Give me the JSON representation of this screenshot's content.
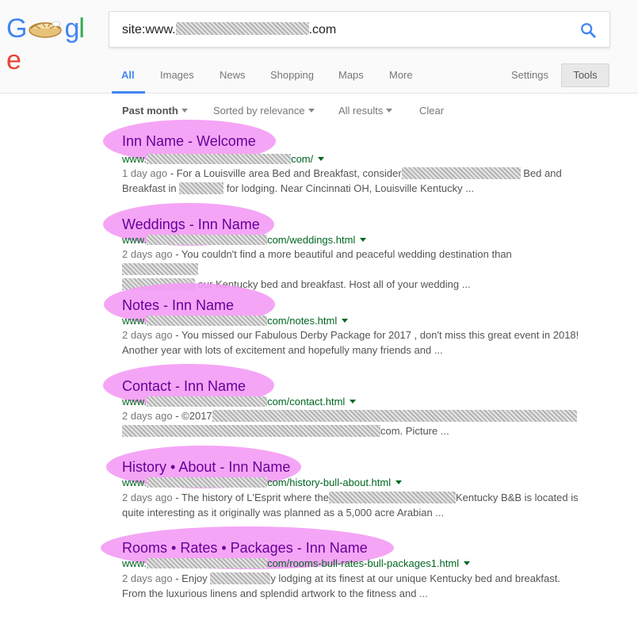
{
  "search": {
    "query_prefix": "site:www.",
    "query_suffix": ".com"
  },
  "logo": {
    "g1": "G",
    "g2": "g",
    "l": "l",
    "e": "e"
  },
  "tabs": [
    {
      "label": "All",
      "active": true
    },
    {
      "label": "Images"
    },
    {
      "label": "News"
    },
    {
      "label": "Shopping"
    },
    {
      "label": "Maps"
    },
    {
      "label": "More"
    }
  ],
  "settings_label": "Settings",
  "tools_label": "Tools",
  "filters": {
    "time": "Past month",
    "sort": "Sorted by relevance",
    "results": "All results",
    "clear": "Clear"
  },
  "results": [
    {
      "title": "Inn Name  - Welcome",
      "url_prefix": "www.",
      "url_suffix": "com/",
      "snippet_date": "1 day ago",
      "snippet_a": " - For a Louisville area Bed and Breakfast, consider",
      "snippet_b": " Bed and",
      "snippet_c": "Breakfast in",
      "snippet_d": " for lodging. Near Cincinnati OH, Louisville Kentucky ..."
    },
    {
      "title": "Weddings - Inn Name",
      "url_prefix": "www.",
      "url_suffix": "com/weddings.html",
      "snippet_date": "2 days ago",
      "snippet_a": " - You couldn't find a more beautiful and peaceful wedding destination than",
      "snippet_b": " our Kentucky bed and breakfast. Host all of your wedding ..."
    },
    {
      "title": "Notes - Inn Name",
      "url_prefix": "www.",
      "url_suffix": "com/notes.html",
      "snippet_date": "2 days ago",
      "snippet_a": " - You missed our Fabulous Derby Package for 2017 , don't miss this great event in 2018!",
      "snippet_b": "Another year with lots of excitement and hopefully many friends and ..."
    },
    {
      "title": "Contact - Inn Name",
      "url_prefix": "www.",
      "url_suffix": "com/contact.html",
      "snippet_date": "2 days ago",
      "snippet_a": " - ©2017",
      "snippet_b": "com. Picture ..."
    },
    {
      "title": "History • About - Inn Name",
      "url_prefix": "www.",
      "url_suffix": "com/history-bull-about.html",
      "snippet_date": "2 days ago",
      "snippet_a": " - The history of L'Esprit where the",
      "snippet_b": "Kentucky B&B is located is",
      "snippet_c": "quite interesting as it originally was planned as a 5,000 acre Arabian ..."
    },
    {
      "title": "Rooms • Rates • Packages - Inn Name",
      "url_prefix": "www.",
      "url_suffix": "com/rooms-bull-rates-bull-packages1.html",
      "snippet_date": "2 days ago",
      "snippet_a": " - Enjoy",
      "snippet_b": "y lodging at its finest at our unique Kentucky bed and breakfast.",
      "snippet_c": "From the luxurious linens and splendid artwork to the fitness and ..."
    }
  ],
  "colors": {
    "highlight": "#f49bf4",
    "title": "#660099",
    "url": "#006621",
    "accent": "#4285f4"
  }
}
